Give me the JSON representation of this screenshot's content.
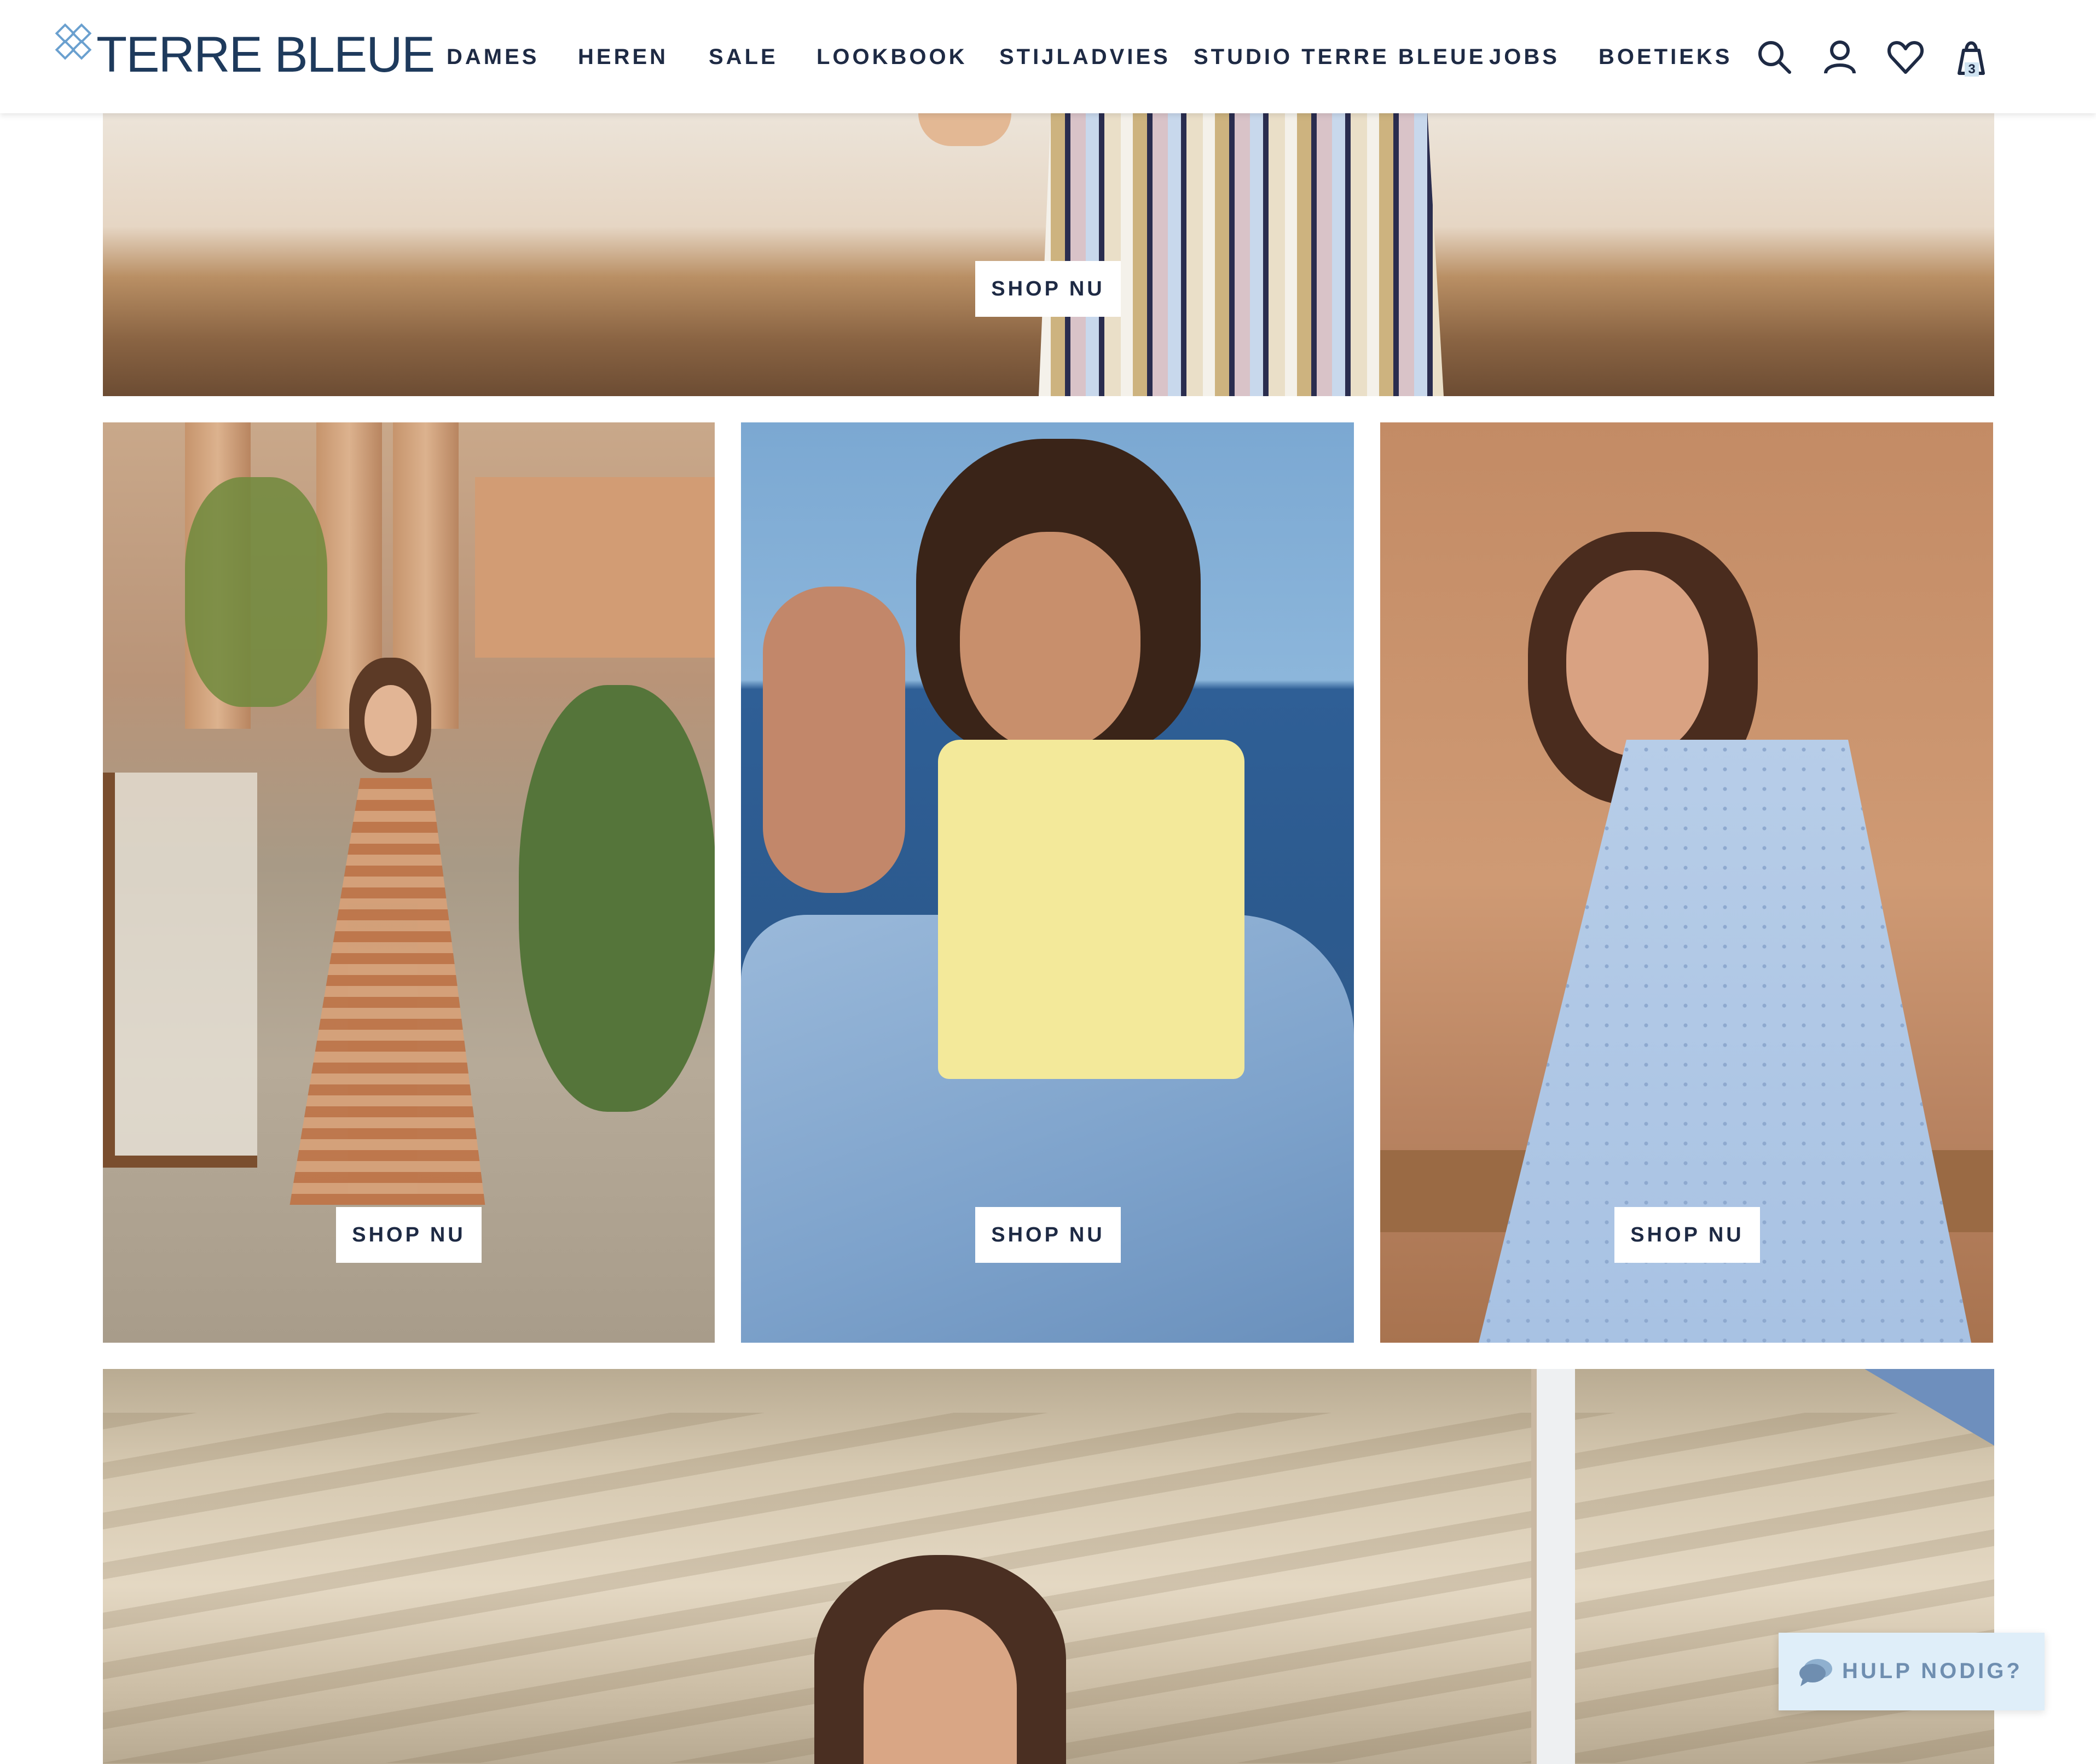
{
  "brand": {
    "name": "TERRE BLEUE",
    "color": "#1e3a5c",
    "mark_color": "#6aa0cf"
  },
  "nav": {
    "items": [
      {
        "label": "DAMES"
      },
      {
        "label": "HEREN"
      },
      {
        "label": "SALE"
      },
      {
        "label": "LOOKBOOK"
      },
      {
        "label": "STIJLADVIES"
      },
      {
        "label": "STUDIO TERRE BLEUE"
      },
      {
        "label": "JOBS"
      },
      {
        "label": "BOETIEKS"
      }
    ],
    "icons": [
      "search-icon",
      "account-icon",
      "wishlist-heart-icon",
      "cart-bag-icon"
    ],
    "cart_count": "3"
  },
  "tiles": {
    "hero_top": {
      "cta": "SHOP NU"
    },
    "tile_1": {
      "cta": "SHOP NU"
    },
    "tile_2": {
      "cta": "SHOP NU"
    },
    "tile_3": {
      "cta": "SHOP NU"
    }
  },
  "chat": {
    "label": "HULP NODIG?",
    "icon": "chat-bubble-icon",
    "bg": "#dfeef9"
  }
}
